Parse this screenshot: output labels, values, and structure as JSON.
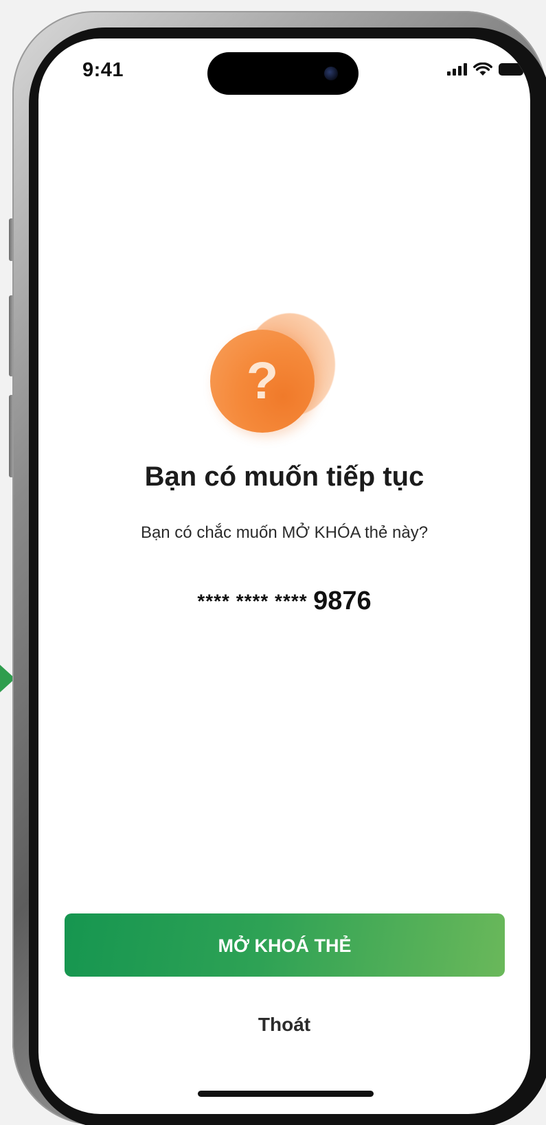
{
  "status_bar": {
    "time": "9:41",
    "icons": [
      "signal-icon",
      "wifi-icon",
      "battery-icon"
    ]
  },
  "illustration": {
    "icon": "question-icon",
    "glyph": "?",
    "colors": {
      "front": "#f5893a",
      "back": "#fbc9a4"
    }
  },
  "dialog": {
    "title": "Bạn có muốn tiếp tục",
    "message": "Bạn có chắc muốn MỞ KHÓA thẻ này?",
    "card_mask": "**** **** ****",
    "card_last4": "9876"
  },
  "actions": {
    "primary_label": "MỞ KHOÁ THẺ",
    "secondary_label": "Thoát"
  },
  "colors": {
    "accent": "#2ea255",
    "accent_light": "#6ab85a",
    "arrow": "#2f9d4e"
  }
}
